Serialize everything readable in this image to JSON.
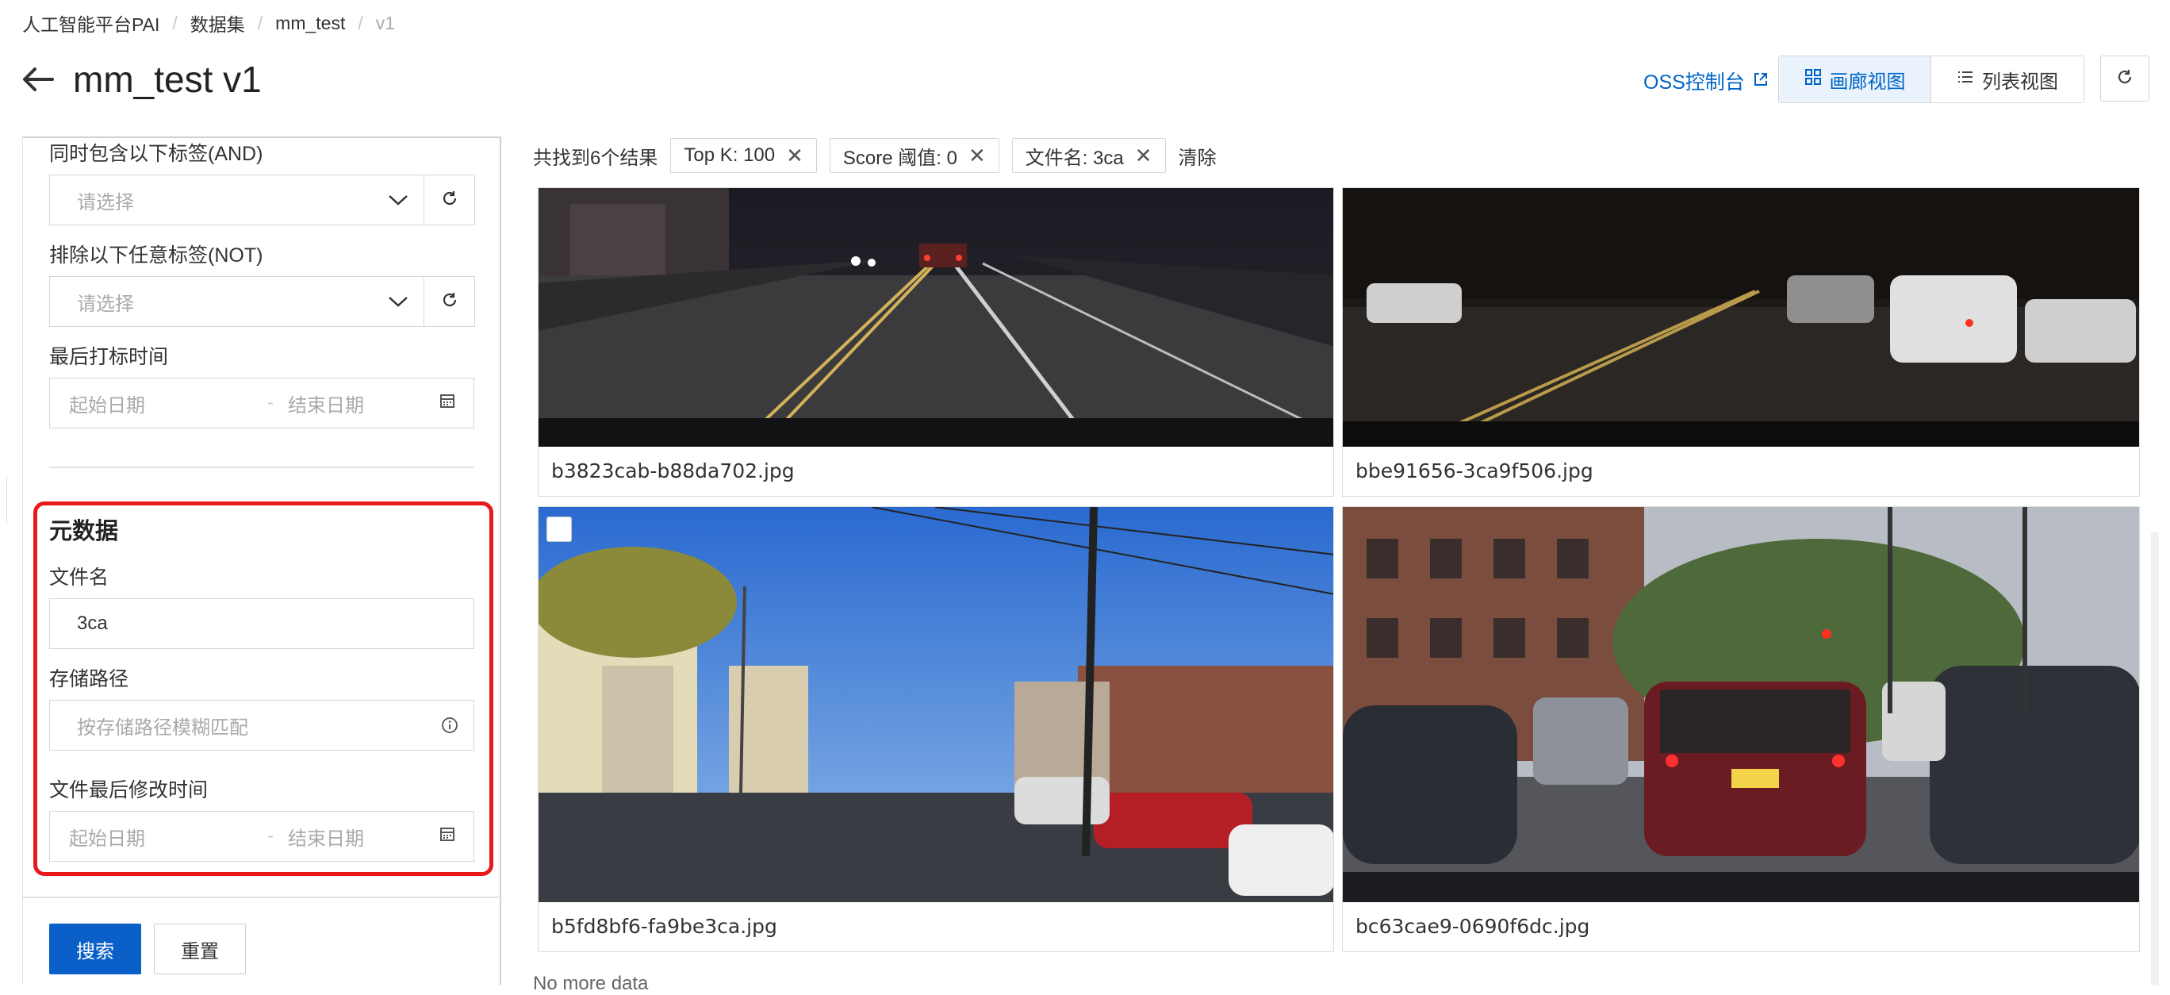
{
  "breadcrumb": {
    "items": [
      "人工智能平台PAI",
      "数据集",
      "mm_test",
      "v1"
    ],
    "separator": "/"
  },
  "header": {
    "title": "mm_test v1",
    "oss_link": "OSS控制台",
    "view_gallery": "画廊视图",
    "view_list": "列表视图"
  },
  "filters": {
    "and_tags_label": "同时包含以下标签(AND)",
    "and_tags_placeholder": "请选择",
    "not_tags_label": "排除以下任意标签(NOT)",
    "not_tags_placeholder": "请选择",
    "last_label_time_label": "最后打标时间",
    "date_start_placeholder": "起始日期",
    "date_end_placeholder": "结束日期",
    "date_dash": "-",
    "metadata_title": "元数据",
    "filename_label": "文件名",
    "filename_value": "3ca",
    "storage_path_label": "存储路径",
    "storage_path_placeholder": "按存储路径模糊匹配",
    "modified_time_label": "文件最后修改时间",
    "search_button": "搜索",
    "reset_button": "重置"
  },
  "results": {
    "summary": "共找到6个结果",
    "tags": [
      "Top K: 100",
      "Score 阈值: 0",
      "文件名: 3ca"
    ],
    "clear": "清除",
    "cards": [
      {
        "filename": "b3823cab-b88da702.jpg"
      },
      {
        "filename": "bbe91656-3ca9f506.jpg"
      },
      {
        "filename": "b5fd8bf6-fa9be3ca.jpg"
      },
      {
        "filename": "bc63cae9-0690f6dc.jpg"
      }
    ],
    "footer": "No more data"
  },
  "colors": {
    "primary": "#0a5fc8",
    "link": "#0064c8",
    "highlight_box": "#e8191a"
  }
}
